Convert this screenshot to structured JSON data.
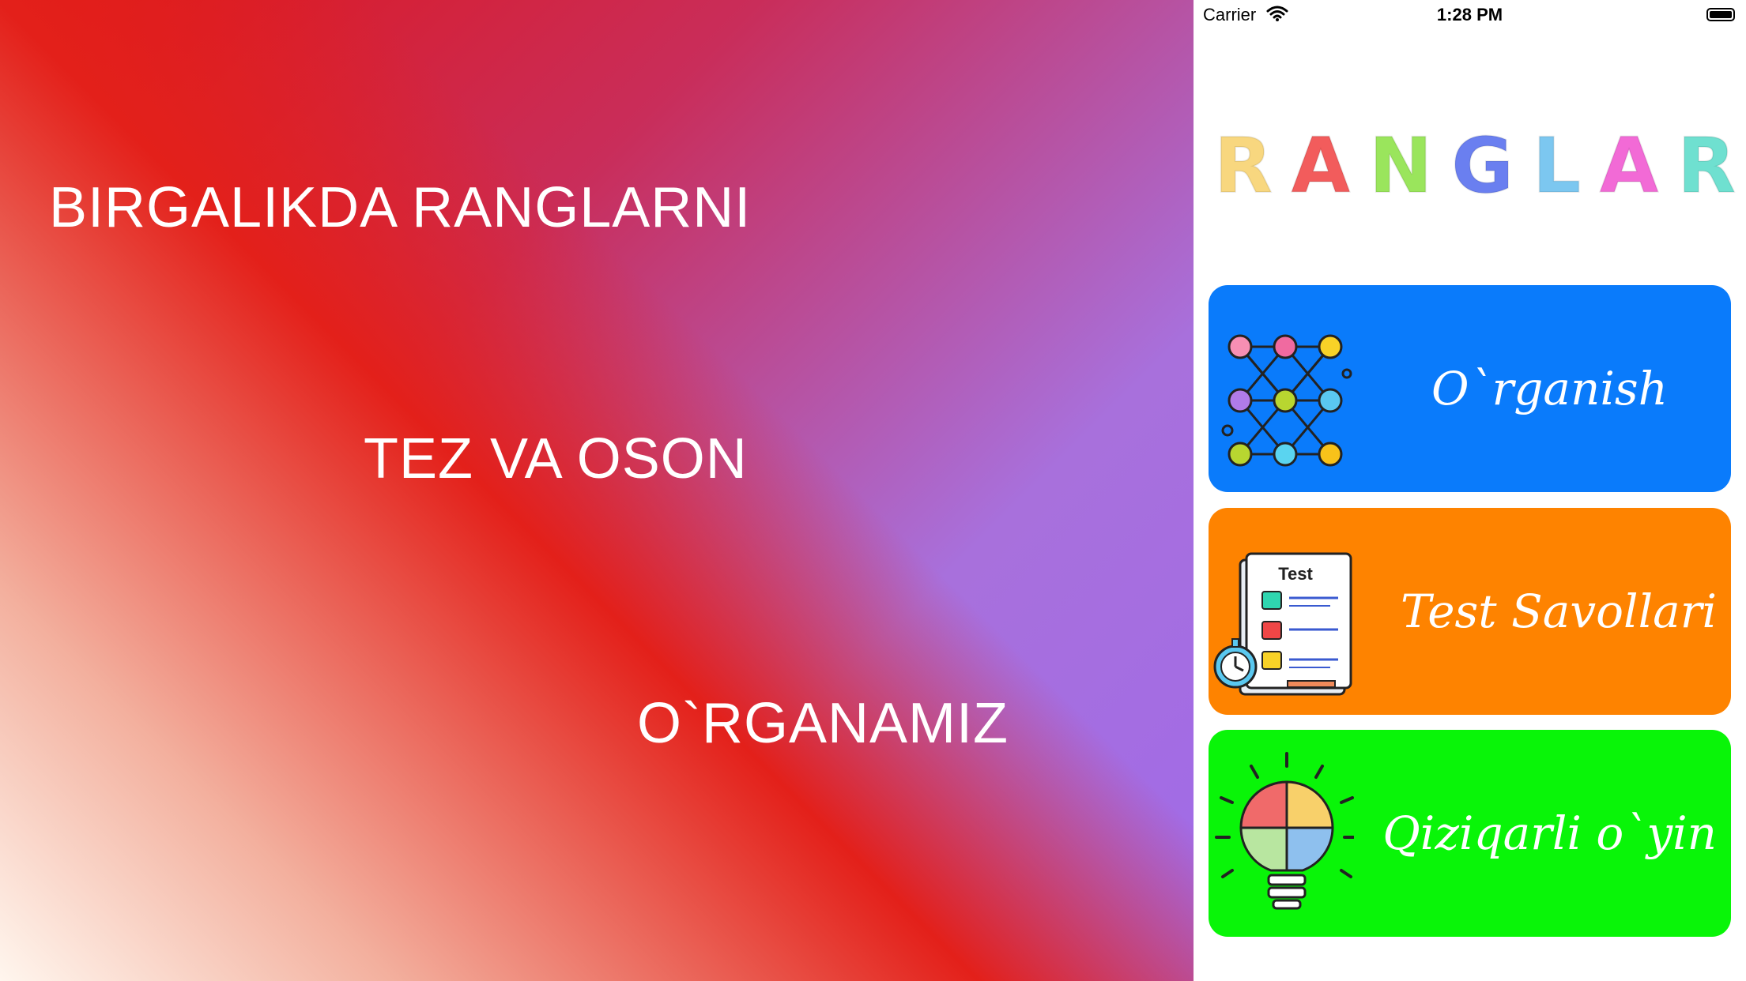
{
  "status_bar": {
    "carrier": "Carrier",
    "time": "1:28 PM"
  },
  "slogans": [
    "BIRGALIKDA RANGLARNI",
    "TEZ VA OSON",
    "O`RGANAMIZ"
  ],
  "logo": {
    "letters": [
      "R",
      "A",
      "N",
      "G",
      "L",
      "A",
      "R"
    ],
    "colors": [
      "#f8d77f",
      "#f25c5c",
      "#9ae55c",
      "#6a7ff0",
      "#7cc7f0",
      "#f26ad6",
      "#6fe0d0"
    ]
  },
  "menu": [
    {
      "label": "O`rganish",
      "color": "#0a7bfb",
      "icon": "network-graph-icon"
    },
    {
      "label": "Test Savollari",
      "color": "#fe8300",
      "icon": "test-sheet-icon",
      "icon_text": "Test"
    },
    {
      "label": "Qiziqarli o`yin",
      "color": "#09f508",
      "icon": "puzzle-bulb-icon"
    }
  ]
}
